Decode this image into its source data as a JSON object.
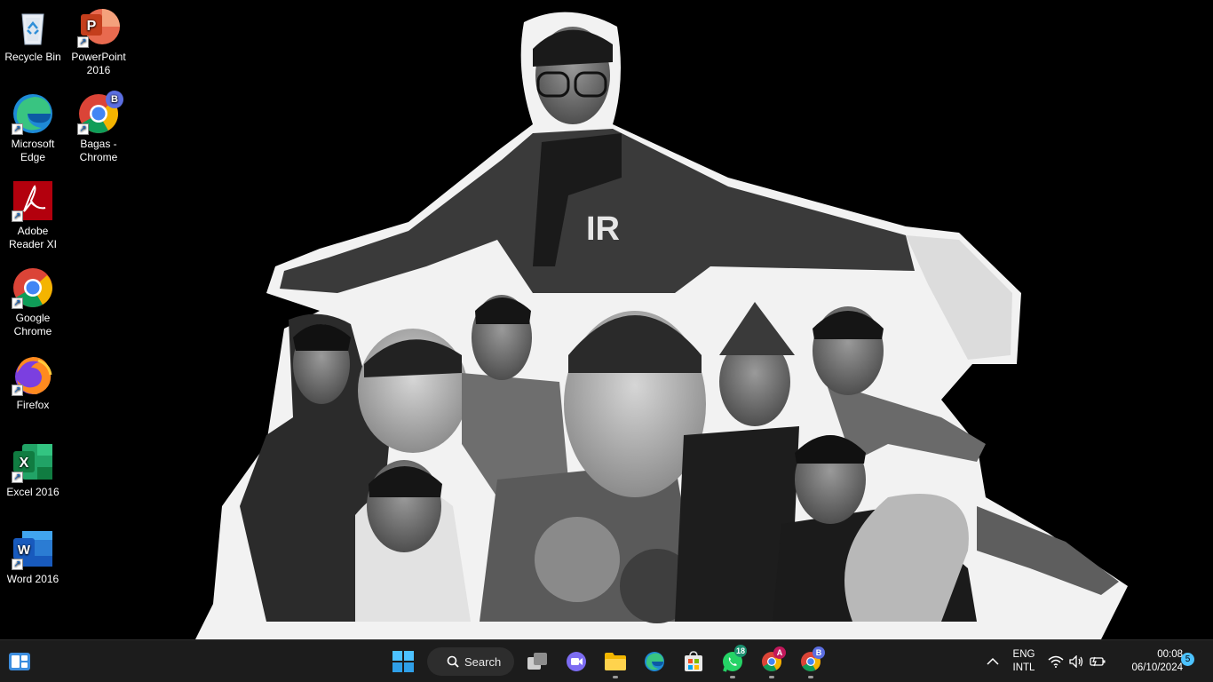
{
  "desktop": {
    "icons": [
      {
        "label": "Recycle Bin",
        "icon": "recycle-bin-icon"
      },
      {
        "label": "PowerPoint\n2016",
        "icon": "powerpoint-icon"
      },
      {
        "label": "Microsoft\nEdge",
        "icon": "edge-icon"
      },
      {
        "label": "Bagas -\nChrome",
        "icon": "chrome-profile-icon",
        "badge": "B"
      },
      {
        "label": "Adobe\nReader XI",
        "icon": "adobe-reader-icon"
      },
      {
        "label": "Google\nChrome",
        "icon": "chrome-icon"
      },
      {
        "label": "Firefox",
        "icon": "firefox-icon"
      },
      {
        "label": "Excel 2016",
        "icon": "excel-icon"
      },
      {
        "label": "Word 2016",
        "icon": "word-icon"
      }
    ]
  },
  "taskbar": {
    "search_label": "Search",
    "apps": [
      {
        "name": "widgets",
        "icon": "widgets-icon"
      },
      {
        "name": "start",
        "icon": "windows-start-icon"
      },
      {
        "name": "task-view",
        "icon": "task-view-icon"
      },
      {
        "name": "meet",
        "icon": "meet-icon"
      },
      {
        "name": "file-explorer",
        "icon": "folder-icon"
      },
      {
        "name": "edge",
        "icon": "edge-icon"
      },
      {
        "name": "store",
        "icon": "store-icon"
      },
      {
        "name": "whatsapp",
        "icon": "whatsapp-icon",
        "badge": "18"
      },
      {
        "name": "chrome-a",
        "icon": "chrome-icon",
        "badge": "A"
      },
      {
        "name": "chrome-b",
        "icon": "chrome-icon",
        "badge": "B"
      }
    ],
    "tray": {
      "lang_top": "ENG",
      "lang_bottom": "INTL",
      "time": "00:08",
      "date": "06/10/2024",
      "notification_count": "5"
    }
  },
  "colors": {
    "taskbar_bg": "#1c1c1c",
    "accent": "#4cc2ff",
    "desktop_bg": "#000000"
  }
}
